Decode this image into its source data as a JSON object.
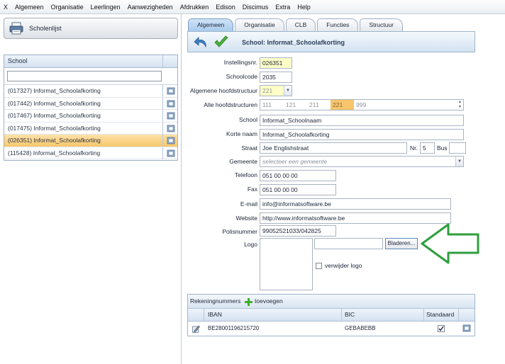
{
  "menu": [
    "X",
    "Algemeen",
    "Organisatie",
    "Leerlingen",
    "Aanwezigheden",
    "Afdrukken",
    "Edison",
    "Discimus",
    "Extra",
    "Help"
  ],
  "left": {
    "button_label": "Scholenlijst",
    "column_header": "School",
    "filter_value": "",
    "schools": [
      {
        "label": "(017327) Informat_Schoolafkorting",
        "selected": false
      },
      {
        "label": "(017442) Informat_Schoolafkorting",
        "selected": false
      },
      {
        "label": "(017467) Informat_Schoolafkorting",
        "selected": false
      },
      {
        "label": "(017475) Informat_Schoolafkorting",
        "selected": false
      },
      {
        "label": "(026351) Informat_Schoolafkorting",
        "selected": true
      },
      {
        "label": "(115428) Informat_Schoolafkorting",
        "selected": false
      }
    ]
  },
  "tabs": [
    {
      "label": "Algemeen",
      "active": true
    },
    {
      "label": "Organisatie",
      "active": false
    },
    {
      "label": "CLB",
      "active": false
    },
    {
      "label": "Functies",
      "active": false
    },
    {
      "label": "Structuur",
      "active": false
    }
  ],
  "title": "School: Informat_Schoolafkorting",
  "form": {
    "instellingsnr": {
      "label": "Instellingsnr.",
      "value": "026351"
    },
    "schoolcode": {
      "label": "Schoolcode",
      "value": "2035"
    },
    "hoofdstructuur": {
      "label": "Algemene hoofdstructuur",
      "value": "221"
    },
    "alle_hoofdstructuren": {
      "label": "Alle hoofdstructuren",
      "values": [
        "111",
        "121",
        "211",
        "221",
        "999"
      ],
      "selected": "221"
    },
    "school": {
      "label": "School",
      "value": "Informat_Schoolnaam"
    },
    "korte_naam": {
      "label": "Korte naam",
      "value": "Informat_Schoolafkorting"
    },
    "straat": {
      "label": "Straat",
      "value": "Joe Englishstraat"
    },
    "nr": {
      "label": "Nr.",
      "value": "5"
    },
    "bus": {
      "label": "Bus",
      "value": ""
    },
    "gemeente": {
      "label": "Gemeente",
      "placeholder": "selecteer een gemeente"
    },
    "telefoon": {
      "label": "Telefoon",
      "value": "051 00 00 00"
    },
    "fax": {
      "label": "Fax",
      "value": "051 00 00 00"
    },
    "email": {
      "label": "E-mail",
      "value": "info@informatsoftware.be"
    },
    "website": {
      "label": "Website",
      "value": "http://www.informatsoftware.be"
    },
    "polisnummer": {
      "label": "Polisnummer",
      "value": "99052521033/042825"
    },
    "logo": {
      "label": "Logo",
      "path": "",
      "browse_label": "Bladeren...",
      "remove_label": "verwijder logo"
    }
  },
  "accounts": {
    "title": "Rekeningnummers",
    "add_label": "toevoegen",
    "columns": [
      "IBAN",
      "BIC",
      "Standaard"
    ],
    "rows": [
      {
        "iban": "BE28001196215720",
        "bic": "GEBABEBB",
        "standaard": true
      }
    ]
  },
  "colors": {
    "selection": "#f8c76a",
    "required_field": "#ffffc8",
    "annotation_arrow": "#2e9e3c"
  }
}
